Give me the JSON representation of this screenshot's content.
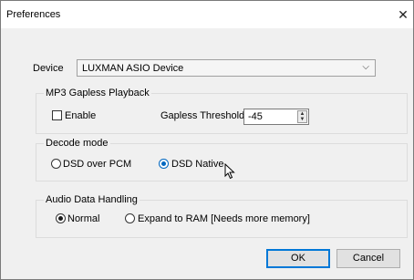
{
  "window": {
    "title": "Preferences",
    "close_glyph": "✕"
  },
  "device": {
    "label": "Device",
    "selected": "LUXMAN ASIO Device",
    "arrow": "⌵"
  },
  "mp3": {
    "group_title": "MP3 Gapless Playback",
    "enable_label": "Enable",
    "enable_checked": false,
    "threshold_label": "Gapless Threshold",
    "threshold_value": "-45"
  },
  "decode": {
    "group_title": "Decode mode",
    "options": [
      {
        "label": "DSD over PCM",
        "selected": false
      },
      {
        "label": "DSD Native",
        "selected": true
      }
    ]
  },
  "audio": {
    "group_title": "Audio Data Handling",
    "options": [
      {
        "label": "Normal",
        "selected": true
      },
      {
        "label": "Expand to RAM [Needs more memory]",
        "selected": false
      }
    ]
  },
  "buttons": {
    "ok": "OK",
    "cancel": "Cancel"
  },
  "colors": {
    "accent": "#0078d7",
    "window_bg": "#f0f0f0",
    "titlebar_bg": "#ffffff"
  },
  "icons": {
    "close": "close-icon",
    "dropdown": "chevron-down-icon",
    "cursor": "mouse-pointer-icon"
  }
}
